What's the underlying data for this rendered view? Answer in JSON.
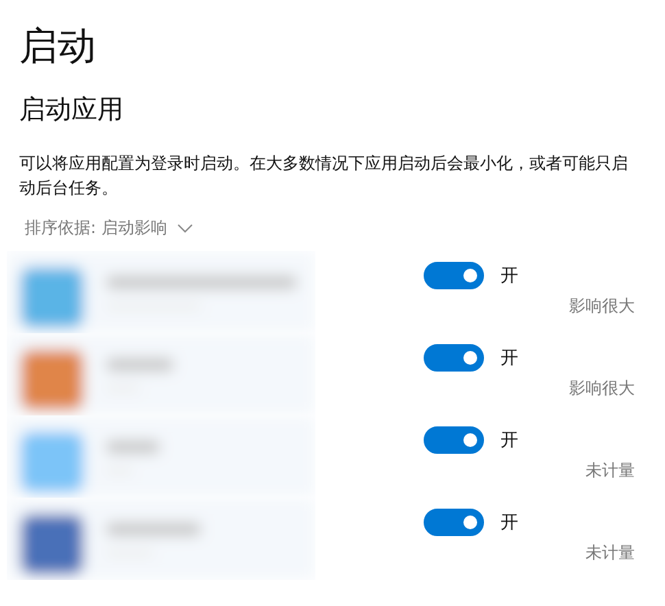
{
  "title": "启动",
  "section_title": "启动应用",
  "description": "可以将应用配置为登录时启动。在大多数情况下应用启动后会最小化，或者可能只启动后台任务。",
  "sort": {
    "label": "排序依据: 启动影响"
  },
  "apps": [
    {
      "kind": "picture",
      "on": true,
      "switch_label": "开",
      "impact": "影响很大"
    },
    {
      "kind": "picture",
      "on": true,
      "switch_label": "开",
      "impact": "影响很大"
    },
    {
      "kind": "picture",
      "on": true,
      "switch_label": "开",
      "impact": "未计量"
    },
    {
      "kind": "picture",
      "on": true,
      "switch_label": "开",
      "impact": "未计量"
    }
  ]
}
